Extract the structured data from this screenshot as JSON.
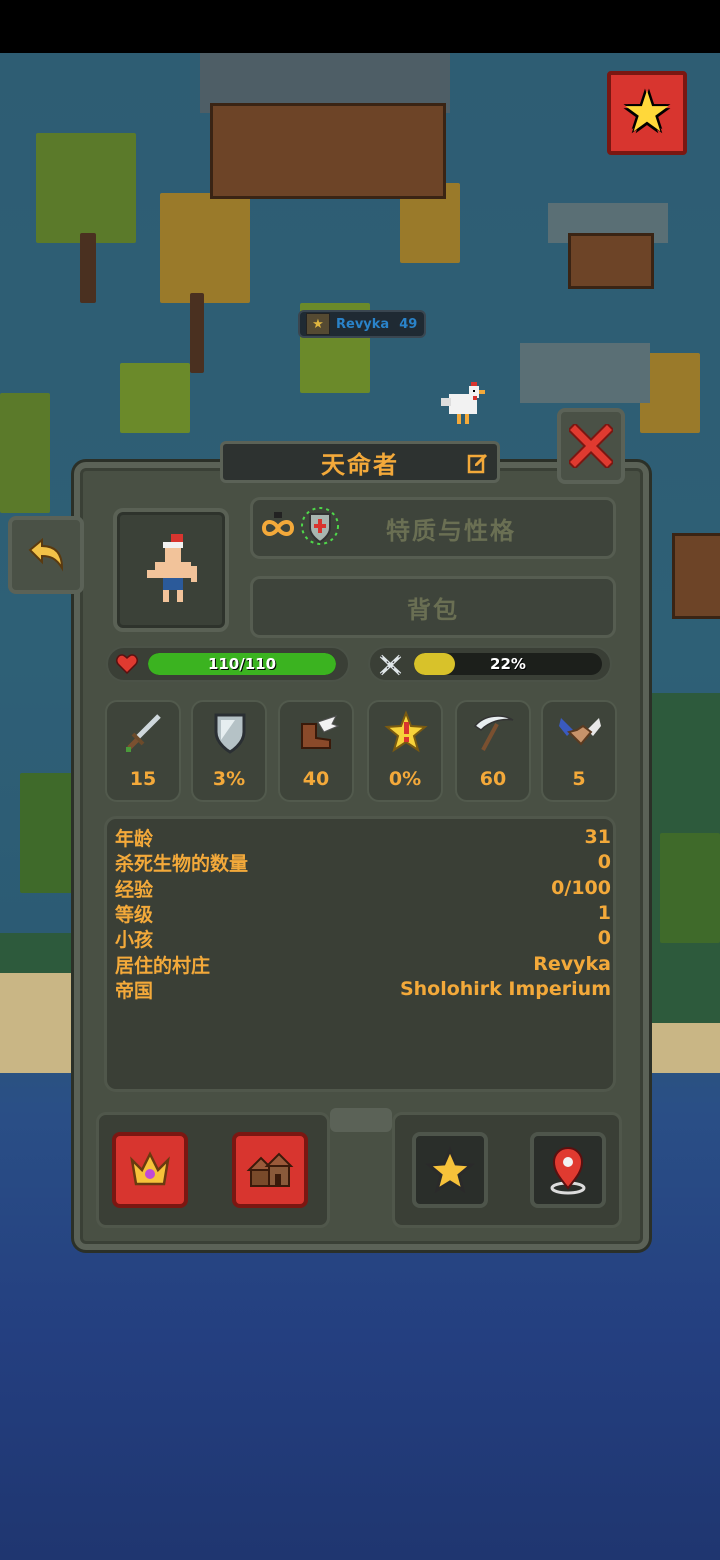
{
  "hud": {
    "favorite_icon": "star-icon",
    "village_label": {
      "name": "Revyka",
      "count": "49"
    }
  },
  "panel": {
    "title": "天命者",
    "traits_label": "特质与性格",
    "inventory_label": "背包",
    "health": {
      "text": "110/110",
      "fraction": 1.0,
      "color": "#3bb320"
    },
    "hunger": {
      "text": "22%",
      "fraction": 0.22,
      "color": "#d8c22a"
    },
    "stats": [
      {
        "icon": "sword-icon",
        "value": "15"
      },
      {
        "icon": "shield-icon",
        "value": "3%"
      },
      {
        "icon": "winged-boot-icon",
        "value": "40"
      },
      {
        "icon": "critical-star-icon",
        "value": "0%"
      },
      {
        "icon": "scythe-icon",
        "value": "60"
      },
      {
        "icon": "handshake-icon",
        "value": "5"
      }
    ],
    "info": [
      {
        "label": "年龄",
        "value": "31"
      },
      {
        "label": "杀死生物的数量",
        "value": "0"
      },
      {
        "label": "经验",
        "value": "0/100"
      },
      {
        "label": "等级",
        "value": "1"
      },
      {
        "label": "小孩",
        "value": "0"
      },
      {
        "label": "居住的村庄",
        "value": "Revyka"
      },
      {
        "label": "帝国",
        "value": "Sholohirk Imperium"
      }
    ]
  },
  "colors": {
    "accent_text": "#f3a93a",
    "panel": "#495044",
    "danger": "#d8352f"
  }
}
